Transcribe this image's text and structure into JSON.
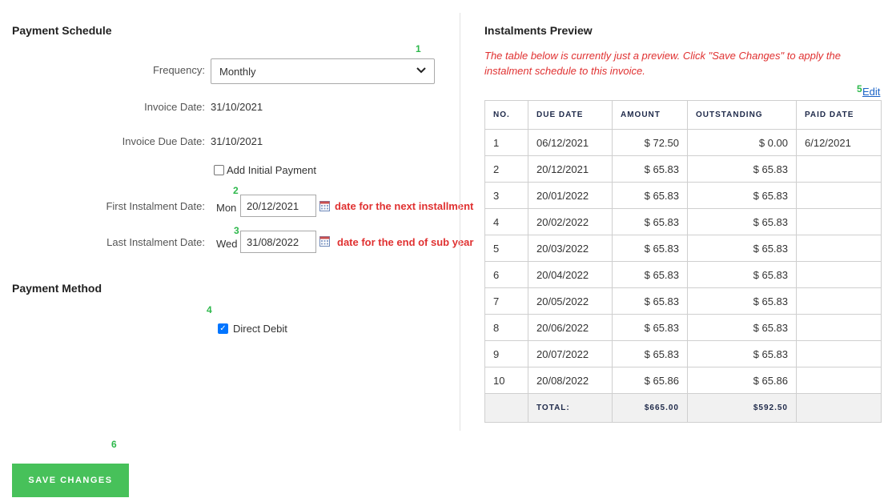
{
  "payment_schedule": {
    "title": "Payment Schedule",
    "frequency_label": "Frequency:",
    "frequency_value": "Monthly",
    "invoice_date_label": "Invoice Date:",
    "invoice_date_value": "31/10/2021",
    "invoice_due_date_label": "Invoice Due Date:",
    "invoice_due_date_value": "31/10/2021",
    "add_initial_payment_label": "Add Initial Payment",
    "first_instalment_label": "First Instalment Date:",
    "first_instalment_day": "Mon",
    "first_instalment_value": "20/12/2021",
    "first_instalment_note": "date for the next installment",
    "last_instalment_label": "Last Instalment Date:",
    "last_instalment_day": "Wed",
    "last_instalment_value": "31/08/2022",
    "last_instalment_note": "date for the end of sub year"
  },
  "payment_method": {
    "title": "Payment Method",
    "direct_debit_label": "Direct Debit"
  },
  "markers": [
    "1",
    "2",
    "3",
    "4",
    "5",
    "6"
  ],
  "preview": {
    "title": "Instalments Preview",
    "note": "The table below is currently just a preview. Click \"Save Changes\" to apply the instalment schedule to this invoice.",
    "edit_label": "Edit",
    "headers": [
      "NO.",
      "DUE DATE",
      "AMOUNT",
      "OUTSTANDING",
      "PAID DATE"
    ],
    "rows": [
      [
        "1",
        "06/12/2021",
        "$ 72.50",
        "$ 0.00",
        "6/12/2021"
      ],
      [
        "2",
        "20/12/2021",
        "$ 65.83",
        "$ 65.83",
        ""
      ],
      [
        "3",
        "20/01/2022",
        "$ 65.83",
        "$ 65.83",
        ""
      ],
      [
        "4",
        "20/02/2022",
        "$ 65.83",
        "$ 65.83",
        ""
      ],
      [
        "5",
        "20/03/2022",
        "$ 65.83",
        "$ 65.83",
        ""
      ],
      [
        "6",
        "20/04/2022",
        "$ 65.83",
        "$ 65.83",
        ""
      ],
      [
        "7",
        "20/05/2022",
        "$ 65.83",
        "$ 65.83",
        ""
      ],
      [
        "8",
        "20/06/2022",
        "$ 65.83",
        "$ 65.83",
        ""
      ],
      [
        "9",
        "20/07/2022",
        "$ 65.83",
        "$ 65.83",
        ""
      ],
      [
        "10",
        "20/08/2022",
        "$ 65.86",
        "$ 65.86",
        ""
      ]
    ],
    "total_label": "TOTAL:",
    "total_amount": "$665.00",
    "total_outstanding": "$592.50"
  },
  "save_label": "SAVE CHANGES",
  "colors": {
    "accent_green": "#47c15a",
    "annotation_red": "#e03131",
    "marker_green": "#2db84b",
    "link_blue": "#1a63c7"
  },
  "icons": [
    "calendar-icon",
    "chevron-down-icon"
  ]
}
